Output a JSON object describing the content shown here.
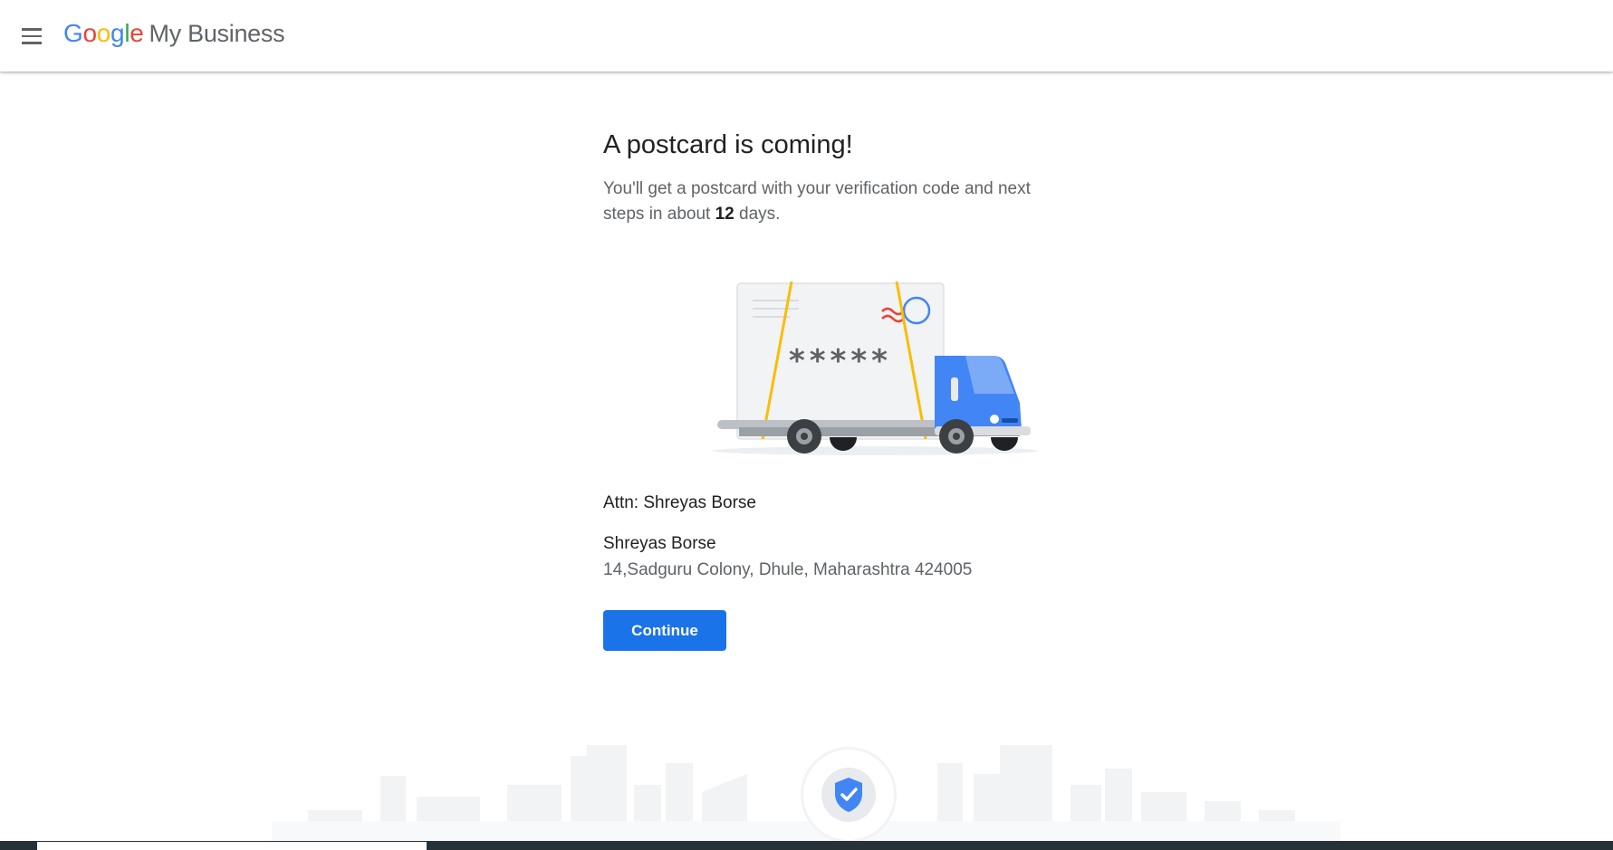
{
  "header": {
    "logo_google": [
      "G",
      "o",
      "o",
      "g",
      "l",
      "e"
    ],
    "logo_product": "My Business",
    "menu_icon": "hamburger-menu-icon"
  },
  "main": {
    "title": "A postcard is coming!",
    "subtitle_before": "You'll get a postcard with your verification code and next steps in about ",
    "subtitle_days": "12",
    "subtitle_after": " days.",
    "illustration_code": "*****",
    "attn": "Attn: Shreyas Borse",
    "address_name": "Shreyas Borse",
    "address_line": "14,Sadguru Colony, Dhule, Maharashtra 424005",
    "continue_label": "Continue"
  },
  "footer": {
    "badge_icon": "verified-shield-icon"
  },
  "colors": {
    "accent": "#1a73e8",
    "truck": "#4285f4",
    "strap": "#fbbc04"
  }
}
